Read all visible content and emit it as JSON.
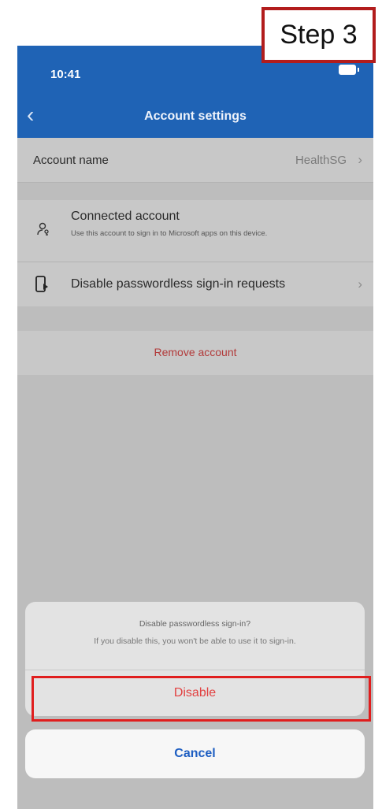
{
  "status_bar": {
    "time": "10:41"
  },
  "nav": {
    "title": "Account settings",
    "back_icon": "chevron-left-icon"
  },
  "account_row": {
    "label": "Account name",
    "value": "HealthSG"
  },
  "connected_row": {
    "title": "Connected account",
    "description": "Use this account to sign in to Microsoft apps on this device.",
    "icon": "person-key-icon"
  },
  "disable_row": {
    "label": "Disable passwordless sign-in requests",
    "icon": "phone-icon"
  },
  "remove_row": {
    "label": "Remove account"
  },
  "action_sheet": {
    "title": "Disable passwordless sign-in?",
    "message": "If you disable this, you won't be able to use it to sign-in.",
    "disable_label": "Disable",
    "cancel_label": "Cancel"
  },
  "step_badge": {
    "label": "Step 3"
  },
  "colors": {
    "nav_blue": "#1f63b5",
    "destructive_red": "#e24040",
    "highlight_red": "#e01e1e",
    "cancel_blue": "#1f5fc2"
  }
}
